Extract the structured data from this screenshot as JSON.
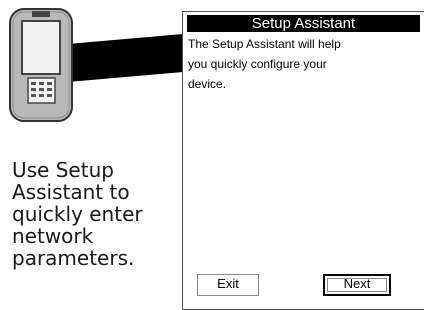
{
  "caption": [
    "Use Setup",
    "Assistant to",
    "quickly enter",
    "network",
    "parameters."
  ],
  "screen": {
    "title": "Setup Assistant",
    "body_lines": [
      "The Setup Assistant will help",
      "you quickly configure your",
      "device."
    ],
    "buttons": {
      "exit": "Exit",
      "next": "Next"
    }
  },
  "colors": {
    "title_bar": "#000000",
    "device_body": "#b9b9b9",
    "device_screen": "#f2f2f2"
  },
  "icons": {
    "device": "handheld-device-illustration"
  }
}
